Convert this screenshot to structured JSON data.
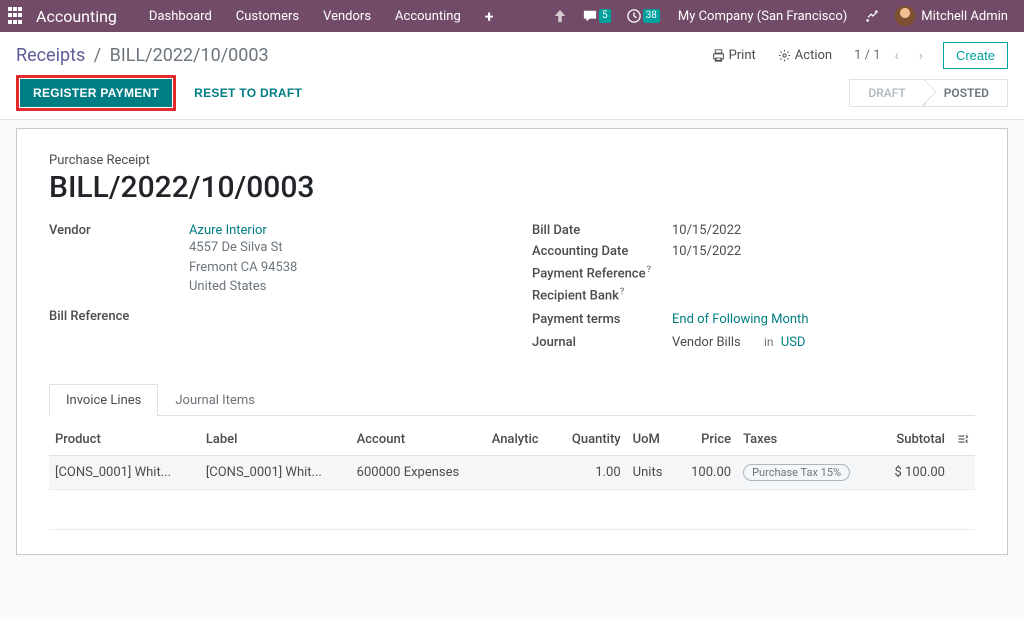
{
  "topnav": {
    "brand": "Accounting",
    "items": [
      "Dashboard",
      "Customers",
      "Vendors",
      "Accounting"
    ],
    "msg_badge": "5",
    "act_badge": "38",
    "company": "My Company (San Francisco)",
    "user": "Mitchell Admin"
  },
  "cp": {
    "bc_root": "Receipts",
    "bc_current": "BILL/2022/10/0003",
    "print": "Print",
    "action": "Action",
    "page_cur": "1",
    "page_total": "1",
    "create": "Create",
    "register": "REGISTER PAYMENT",
    "reset": "RESET TO DRAFT",
    "status_draft": "DRAFT",
    "status_posted": "POSTED"
  },
  "form": {
    "rec_type": "Purchase Receipt",
    "rec_title": "BILL/2022/10/0003",
    "left": {
      "vendor_lbl": "Vendor",
      "vendor_name": "Azure Interior",
      "addr1": "4557 De Silva St",
      "addr2": "Fremont CA 94538",
      "addr3": "United States",
      "billref_lbl": "Bill Reference"
    },
    "right": {
      "billdate_lbl": "Bill Date",
      "billdate": "10/15/2022",
      "acctdate_lbl": "Accounting Date",
      "acctdate": "10/15/2022",
      "payref_lbl": "Payment Reference",
      "recbank_lbl": "Recipient Bank",
      "terms_lbl": "Payment terms",
      "terms": "End of Following Month",
      "journal_lbl": "Journal",
      "journal": "Vendor Bills",
      "in": "in",
      "currency": "USD"
    },
    "tabs": {
      "t1": "Invoice Lines",
      "t2": "Journal Items"
    },
    "cols": {
      "product": "Product",
      "label": "Label",
      "account": "Account",
      "analytic": "Analytic",
      "qty": "Quantity",
      "uom": "UoM",
      "price": "Price",
      "taxes": "Taxes",
      "subtotal": "Subtotal"
    },
    "row": {
      "product": "[CONS_0001] Whit...",
      "label": "[CONS_0001] Whit...",
      "account": "600000 Expenses",
      "qty": "1.00",
      "uom": "Units",
      "price": "100.00",
      "tax": "Purchase Tax 15%",
      "subtotal": "$ 100.00"
    }
  }
}
